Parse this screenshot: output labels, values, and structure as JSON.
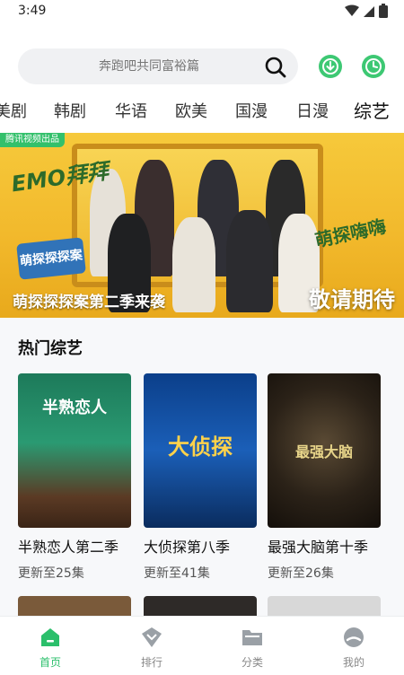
{
  "status_bar": {
    "time": "3:49"
  },
  "search": {
    "placeholder_text": "奔跑吧共同富裕篇"
  },
  "colors": {
    "accent": "#2bbf6b",
    "banner_yellow": "#f2b92c"
  },
  "tabs": [
    {
      "label": "美剧"
    },
    {
      "label": "韩剧"
    },
    {
      "label": "华语"
    },
    {
      "label": "欧美"
    },
    {
      "label": "国漫"
    },
    {
      "label": "日漫"
    },
    {
      "label": "综艺"
    }
  ],
  "banner": {
    "badge": "腾讯视频出品",
    "emo_text": "EMO拜拜",
    "logo_text": "萌探探探案",
    "side_text": "萌探嗨嗨",
    "caption": "萌探探探案第二季来袭",
    "right_text": "敬请期待"
  },
  "section": {
    "title": "热门综艺",
    "cards": [
      {
        "title": "半熟恋人第二季",
        "subtitle": "更新至25集",
        "poster_text": "半熟恋人"
      },
      {
        "title": "大侦探第八季",
        "subtitle": "更新至41集",
        "poster_text": "大侦探"
      },
      {
        "title": "最强大脑第十季",
        "subtitle": "更新至26集",
        "poster_text": "最强大脑"
      }
    ]
  },
  "bottom_nav": [
    {
      "label": "首页",
      "icon": "home-icon"
    },
    {
      "label": "排行",
      "icon": "rank-icon"
    },
    {
      "label": "分类",
      "icon": "folder-icon"
    },
    {
      "label": "我的",
      "icon": "profile-icon"
    }
  ]
}
